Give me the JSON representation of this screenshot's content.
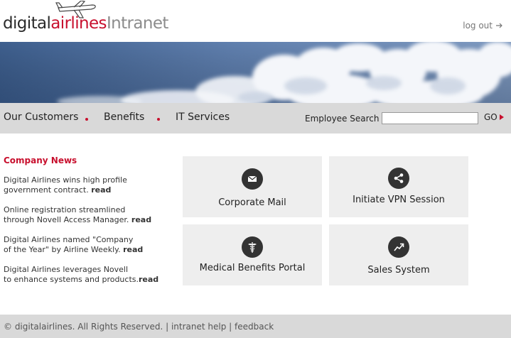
{
  "header": {
    "logo": {
      "part1": "digital",
      "part2": "airlines",
      "part3": "Intranet"
    },
    "logout_label": "log out"
  },
  "nav": {
    "items": [
      "Our Customers",
      "Benefits",
      "IT Services"
    ],
    "search_label": "Employee Search",
    "search_value": "",
    "go_label": "GO"
  },
  "news": {
    "title": "Company News",
    "items": [
      {
        "line1": "Digital Airlines wins high profile",
        "line2": "government contract.",
        "read": "read"
      },
      {
        "line1": "Online registration streamlined",
        "line2": "through Novell Access Manager.",
        "read": "read"
      },
      {
        "line1": "Digital Airlines named \"Company",
        "line2": "of the Year\"  by Airline Weekly.",
        "read": "read"
      },
      {
        "line1": "Digital Airlines leverages Novell",
        "line2": "to enhance systems and products.",
        "read": "read"
      }
    ]
  },
  "tiles": [
    {
      "label": "Corporate Mail",
      "icon": "mail-icon"
    },
    {
      "label": "Initiate VPN Session",
      "icon": "network-icon"
    },
    {
      "label": "Medical Benefits Portal",
      "icon": "caduceus-icon"
    },
    {
      "label": "Sales System",
      "icon": "trend-icon"
    }
  ],
  "footer": {
    "copyright": "© digitalairlines.  All Rights Reserved.",
    "links": [
      "intranet help",
      "feedback"
    ],
    "sep": " | "
  },
  "colors": {
    "brand_red": "#c8102e",
    "nav_bg": "#d9d9d9",
    "tile_bg": "#eeeeee"
  }
}
